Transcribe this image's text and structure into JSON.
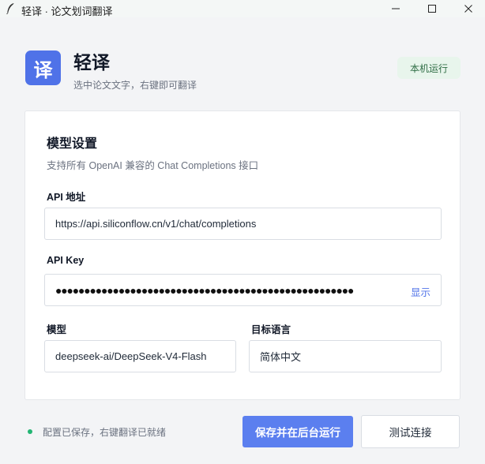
{
  "window": {
    "title": "轻译 · 论文划词翻译",
    "icon": "feather-icon"
  },
  "header": {
    "logo_char": "译",
    "app_name": "轻译",
    "subtitle": "选中论文文字，右键即可翻译",
    "badge": "本机运行"
  },
  "card": {
    "title": "模型设置",
    "subtitle": "支持所有 OpenAI 兼容的 Chat Completions 接口",
    "api_url": {
      "label": "API 地址",
      "value": "https://api.siliconflow.cn/v1/chat/completions"
    },
    "api_key": {
      "label": "API Key",
      "masked": "●●●●●●●●●●●●●●●●●●●●●●●●●●●●●●●●●●●●●●●●●●●●●●●●●●●●",
      "toggle_label": "显示"
    },
    "model": {
      "label": "模型",
      "value": "deepseek-ai/DeepSeek-V4-Flash"
    },
    "target_language": {
      "label": "目标语言",
      "value": "简体中文"
    }
  },
  "footer": {
    "status": "配置已保存，右键翻译已就绪",
    "save_label": "保存并在后台运行",
    "test_label": "测试连接"
  },
  "colors": {
    "accent": "#5b7fef",
    "logo": "#4f72e8",
    "status_ok": "#22b573",
    "badge_bg": "#e8f5ec",
    "badge_text": "#2f6d45"
  }
}
